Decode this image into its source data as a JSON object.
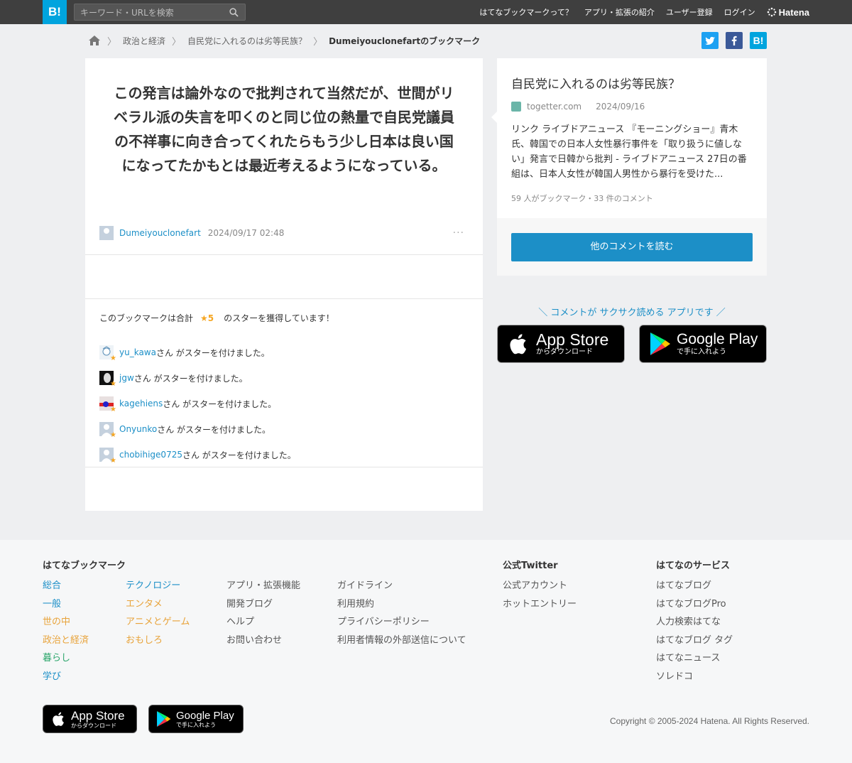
{
  "header": {
    "logo": "B!",
    "search_placeholder": "キーワード・URLを検索",
    "nav": [
      "はてなブックマークって？",
      "アプリ・拡張の紹介",
      "ユーザー登録",
      "ログイン"
    ],
    "brand": "Hatena"
  },
  "breadcrumb": {
    "items": [
      "政治と経済",
      "自民党に入れるのは劣等民族？"
    ],
    "current": "Dumeiyouclonefartのブックマーク"
  },
  "share": {
    "b_label": "B!"
  },
  "comment": {
    "text": "この発言は論外なので批判されて当然だが、世間がリベラル派の失言を叩くのと同じ位の熱量で自民党議員の不祥事に向き合ってくれたらもう少し日本は良い国になってたかもとは最近考えるようになっている。",
    "user": "Dumeiyouclonefart",
    "date": "2024/09/17 02:48",
    "menu": "···"
  },
  "stars": {
    "prefix": "このブックマークは合計",
    "count": "★5",
    "suffix": "のスターを獲得しています！",
    "action_text": "さん がスターを付けました。",
    "users": [
      "yu_kawa",
      "jgw",
      "kagehiens",
      "Onyunko",
      "chobihige0725"
    ]
  },
  "entry": {
    "title": "自民党に入れるのは劣等民族？",
    "domain": "togetter.com",
    "date": "2024/09/16",
    "description": "リンク ライブドアニュース 『モーニングショー』青木氏、韓国での日本人女性暴行事件を「取り扱うに値しない」発言で日韓から批判 - ライブドアニュース 27日の番組は、日本人女性が韓国人男性から暴行を受けた...",
    "counts": "59 人がブックマーク・33 件のコメント",
    "read_button": "他のコメントを読む"
  },
  "promo": {
    "text": "＼ コメントが サクサク読める アプリです ／",
    "appstore_big": "App Store",
    "appstore_small": "からダウンロード",
    "googleplay_big": "Google Play",
    "googleplay_small": "で手に入れよう"
  },
  "footer": {
    "bookmark_heading": "はてなブックマーク",
    "col1": [
      "総合",
      "一般",
      "世の中",
      "政治と経済",
      "暮らし",
      "学び"
    ],
    "col2": [
      "テクノロジー",
      "エンタメ",
      "アニメとゲーム",
      "おもしろ"
    ],
    "col3": [
      "アプリ・拡張機能",
      "開発ブログ",
      "ヘルプ",
      "お問い合わせ"
    ],
    "col4": [
      "ガイドライン",
      "利用規約",
      "プライバシーポリシー",
      "利用者情報の外部送信について"
    ],
    "twitter_heading": "公式Twitter",
    "twitter": [
      "公式アカウント",
      "ホットエントリー"
    ],
    "services_heading": "はてなのサービス",
    "services": [
      "はてなブログ",
      "はてなブログPro",
      "人力検索はてな",
      "はてなブログ タグ",
      "はてなニュース",
      "ソレドコ"
    ],
    "copyright": "Copyright © 2005-2024 Hatena. All Rights Reserved."
  }
}
